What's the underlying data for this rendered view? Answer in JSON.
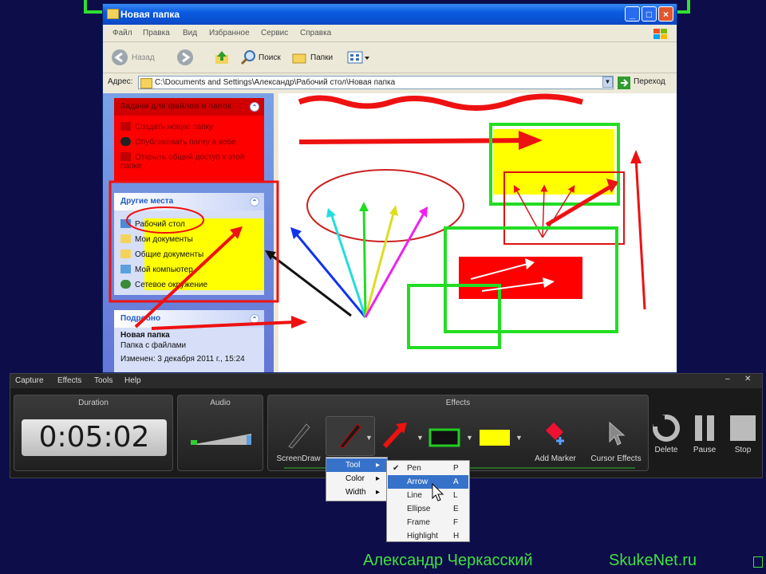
{
  "window": {
    "title": "Новая папка",
    "menu": [
      "Файл",
      "Правка",
      "Вид",
      "Избранное",
      "Сервис",
      "Справка"
    ],
    "toolbar": {
      "back": "Назад",
      "search": "Поиск",
      "folders": "Папки"
    },
    "address_label": "Адрес:",
    "address_value": "C:\\Documents and Settings\\Александр\\Рабочий стол\\Новая папка",
    "go_label": "Переход",
    "tasks_panel": {
      "title": "Задачи для файлов и папок",
      "items": [
        "Создать новую папку",
        "Опубликовать папку в вебе",
        "Открыть общий доступ к этой папке"
      ]
    },
    "places_panel": {
      "title": "Другие места",
      "items": [
        "Рабочий стол",
        "Мои документы",
        "Общие документы",
        "Мой компьютер",
        "Сетевое окружение"
      ]
    },
    "details_panel": {
      "title": "Подробно",
      "name": "Новая папка",
      "type": "Папка с файлами",
      "modified": "Изменен: 3 декабря 2011 г., 15:24"
    }
  },
  "recorder": {
    "menu": [
      "Capture",
      "Effects",
      "Tools",
      "Help"
    ],
    "duration_title": "Duration",
    "duration_value": "0:05:02",
    "audio_title": "Audio",
    "effects_title": "Effects",
    "screendraw_label": "ScreenDraw",
    "add_marker_label": "Add Marker",
    "cursor_effects_label": "Cursor Effects",
    "delete_label": "Delete",
    "pause_label": "Pause",
    "stop_label": "Stop"
  },
  "submenu": {
    "items": [
      "Tool",
      "Color",
      "Width"
    ]
  },
  "tool_menu": {
    "items": [
      {
        "label": "Pen",
        "key": "P",
        "checked": true
      },
      {
        "label": "Arrow",
        "key": "A"
      },
      {
        "label": "Line",
        "key": "L"
      },
      {
        "label": "Ellipse",
        "key": "E"
      },
      {
        "label": "Frame",
        "key": "F"
      },
      {
        "label": "Highlight",
        "key": "H"
      }
    ]
  },
  "footer": {
    "author": "Александр Черкасский",
    "site": "SkukeNet.ru"
  },
  "colors": {
    "capture_frame": "#2fe02f",
    "xp_title": "#0a5be0",
    "draw_red": "#ee1111",
    "draw_green": "#22dd22",
    "highlight_yellow": "#ffff00",
    "menu_highlight": "#3672c9"
  }
}
